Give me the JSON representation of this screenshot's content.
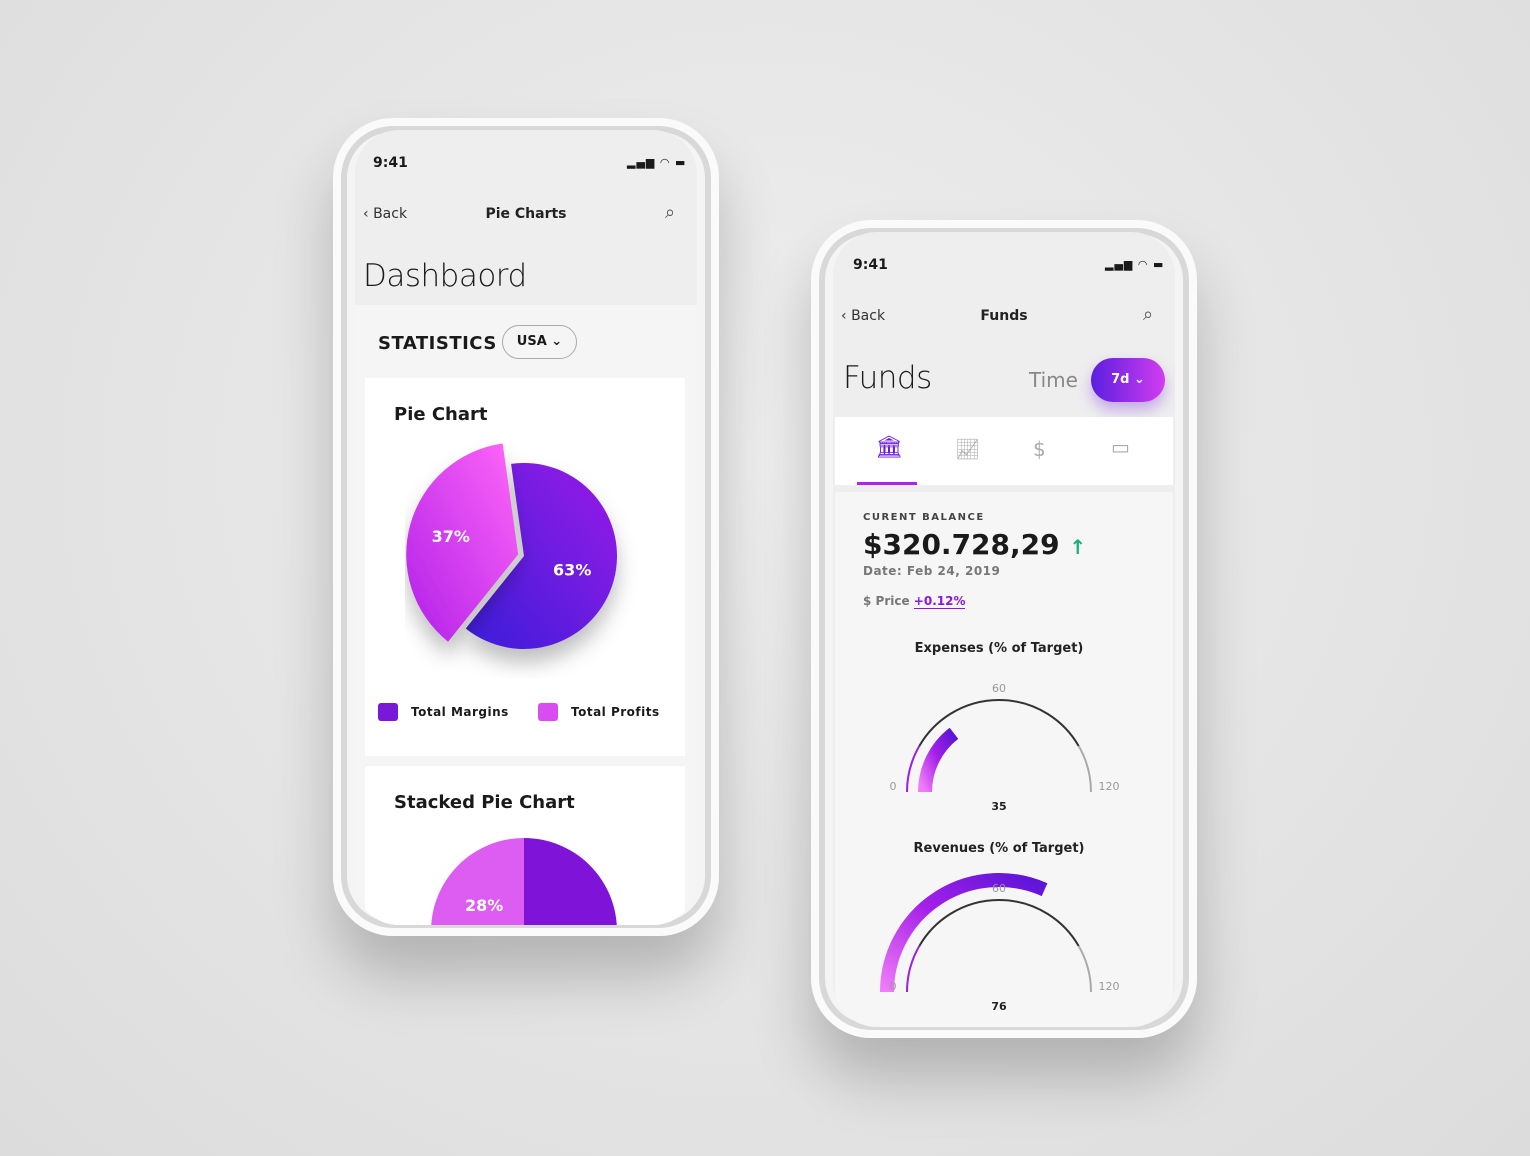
{
  "left": {
    "status_time": "9:41",
    "nav": {
      "back": "Back",
      "title": "Pie Charts"
    },
    "page_title": "Dashbaord",
    "section": "STATISTICS",
    "country": "USA",
    "pie_card": {
      "title": "Pie Chart",
      "legend": [
        "Total Margins",
        "Total Profits"
      ]
    },
    "stacked_card": {
      "title": "Stacked Pie Chart",
      "label": "28%"
    }
  },
  "right": {
    "status_time": "9:41",
    "nav": {
      "back": "Back",
      "title": "Funds"
    },
    "page_title": "Funds",
    "time_label": "Time",
    "time_value": "7d",
    "tabs": [
      "bank-icon",
      "chart-icon",
      "coins-icon",
      "cards-icon"
    ],
    "balance_label": "CURENT BALANCE",
    "currency": "$",
    "balance": "320.728,29",
    "date": "Date: Feb 24, 2019",
    "price_label": "$ Price",
    "price_change": "+0.12%"
  },
  "chart_data": [
    {
      "type": "pie",
      "categories": [
        "Total Margins",
        "Total Profits"
      ],
      "values": [
        63,
        37
      ],
      "labels": [
        "63%",
        "37%"
      ],
      "colors": [
        "#4a1fdc",
        "#e24cf0"
      ]
    },
    {
      "type": "gauge",
      "title": "Expenses (% of Target)",
      "value": 35,
      "range": [
        0,
        120
      ],
      "ticks": [
        "0",
        "60",
        "120"
      ],
      "value_label": "35"
    },
    {
      "type": "gauge",
      "title": "Revenues (% of Target)",
      "value": 76,
      "range": [
        0,
        120
      ],
      "ticks": [
        "0",
        "60",
        "120"
      ],
      "value_label": "76"
    }
  ],
  "colors": {
    "accent": "#8a18e0",
    "pink": "#e85cf5",
    "up": "#1db07a"
  }
}
